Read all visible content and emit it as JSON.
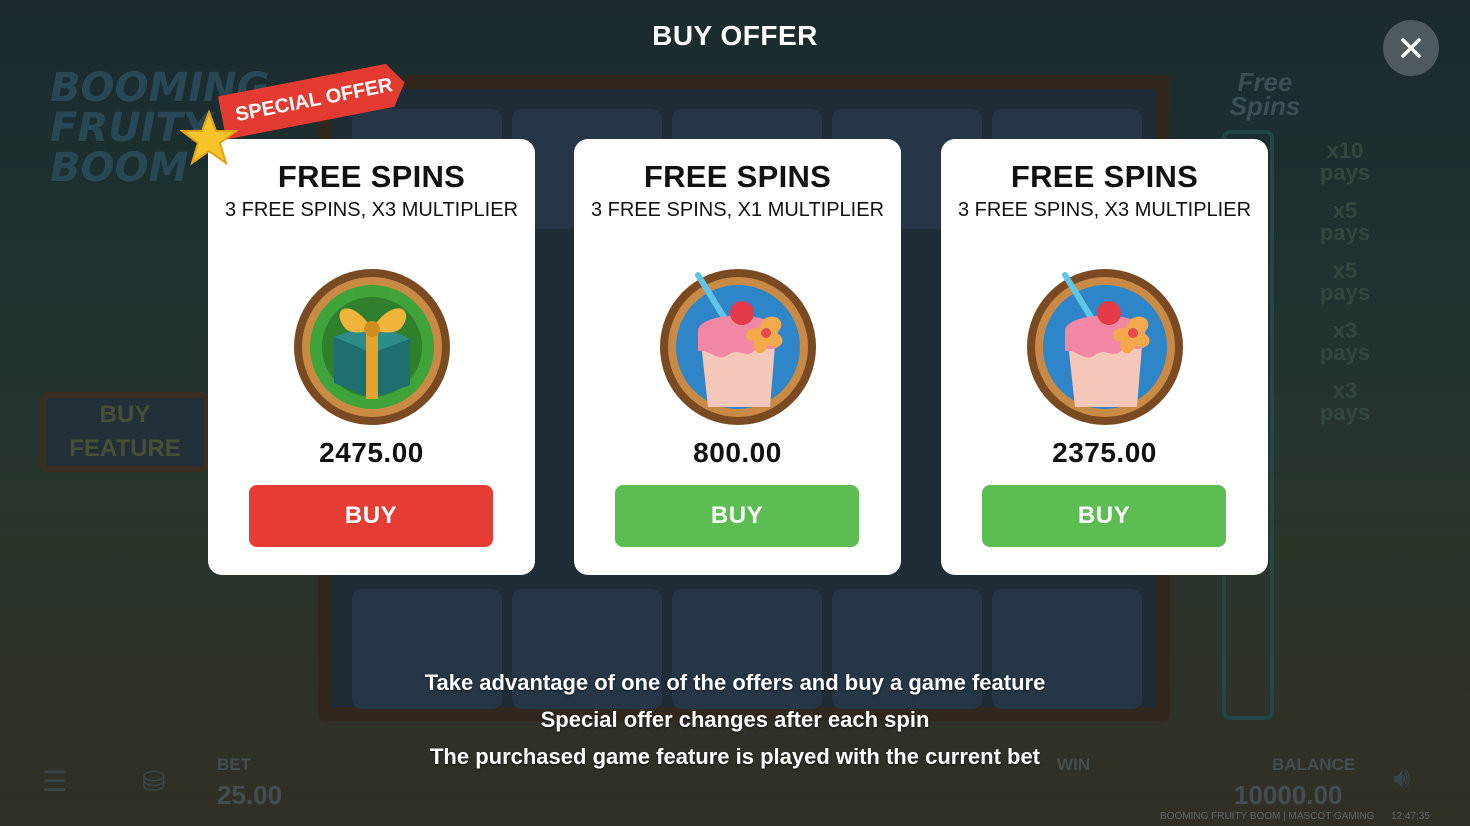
{
  "popup": {
    "title": "BUY OFFER",
    "close_icon": "close-icon"
  },
  "special_offer": {
    "label": "SPECIAL OFFER",
    "icon": "star-icon",
    "ribbon_color": "#e33b31"
  },
  "offers": [
    {
      "title": "FREE SPINS",
      "subtitle": "3 FREE SPINS, X3 MULTIPLIER",
      "icon": "gift-box-icon",
      "price": "2475.00",
      "button_label": "BUY",
      "button_color": "#e53c34"
    },
    {
      "title": "FREE SPINS",
      "subtitle": "3 FREE SPINS, X1 MULTIPLIER",
      "icon": "milkshake-icon",
      "price": "800.00",
      "button_label": "BUY",
      "button_color": "#5cbd52"
    },
    {
      "title": "FREE SPINS",
      "subtitle": "3 FREE SPINS, X3 MULTIPLIER",
      "icon": "milkshake-icon",
      "price": "2375.00",
      "button_label": "BUY",
      "button_color": "#5cbd52"
    }
  ],
  "info_lines": [
    "Take advantage of one of the offers and buy a game feature",
    "Special offer changes after each spin",
    "The purchased game feature is played with the current bet"
  ],
  "background": {
    "logo_text": "BOOMING FRUITY BOOM",
    "buy_feature_label_1": "BUY",
    "buy_feature_label_2": "FEATURE",
    "free_spins_title": "Free Spins",
    "pays": [
      "x10 pays",
      "x5 pays",
      "x5 pays",
      "x3 pays",
      "x3 pays"
    ],
    "bet_label": "BET",
    "bet_value": "25.00",
    "win_label": "WIN",
    "balance_label": "BALANCE",
    "balance_value": "10000.00",
    "footer_game": "BOOMING FRUITY BOOM | MASCOT GAMING",
    "clock": "12:47:35"
  }
}
